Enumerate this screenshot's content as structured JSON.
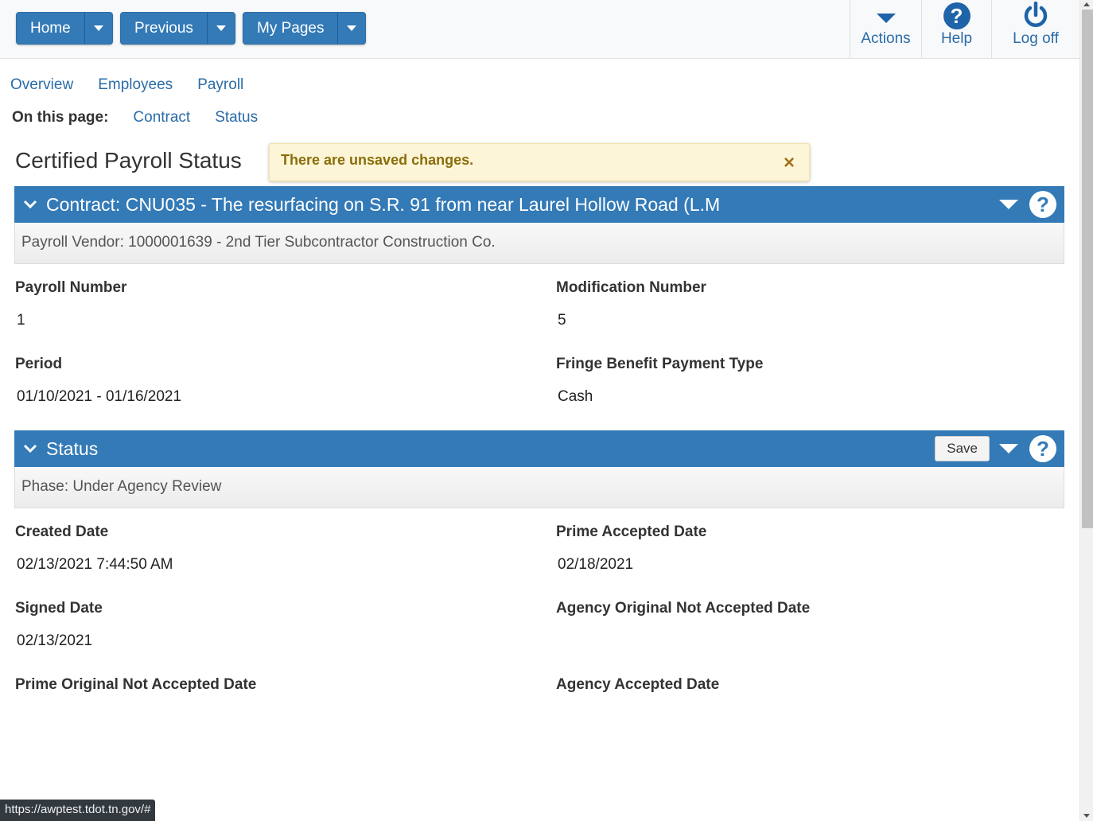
{
  "nav": {
    "home": "Home",
    "previous": "Previous",
    "my_pages": "My Pages"
  },
  "toolbar": {
    "actions": "Actions",
    "help": "Help",
    "logoff": "Log off"
  },
  "tabs": [
    "Overview",
    "Employees",
    "Payroll"
  ],
  "on_this_page": {
    "label": "On this page:",
    "links": [
      "Contract",
      "Status"
    ]
  },
  "page_title": "Certified Payroll Status",
  "alert": {
    "message": "There are unsaved changes.",
    "close": "×"
  },
  "contract_panel": {
    "title": "Contract: CNU035 - The resurfacing on S.R. 91 from near Laurel Hollow Road (L.M",
    "subtitle": "Payroll Vendor: 1000001639 - 2nd Tier Subcontractor Construction Co.",
    "fields": {
      "payroll_number_label": "Payroll Number",
      "payroll_number": "1",
      "modification_number_label": "Modification Number",
      "modification_number": "5",
      "period_label": "Period",
      "period": "01/10/2021 - 01/16/2021",
      "fringe_label": "Fringe Benefit Payment Type",
      "fringe": "Cash"
    }
  },
  "status_panel": {
    "title": "Status",
    "save_label": "Save",
    "subtitle": "Phase: Under Agency Review",
    "fields": {
      "created_label": "Created Date",
      "created": "02/13/2021 7:44:50 AM",
      "prime_accepted_label": "Prime Accepted Date",
      "prime_accepted": "02/18/2021",
      "signed_label": "Signed Date",
      "signed": "02/13/2021",
      "agency_orig_not_accepted_label": "Agency Original Not Accepted Date",
      "prime_orig_not_accepted_label": "Prime Original Not Accepted Date",
      "agency_accepted_label": "Agency Accepted Date"
    }
  },
  "help_glyph": "?",
  "status_url": "https://awptest.tdot.tn.gov/#",
  "colors": {
    "primary": "#337ab7",
    "link": "#2a6ca8",
    "alert_bg": "#fcf5d7"
  }
}
